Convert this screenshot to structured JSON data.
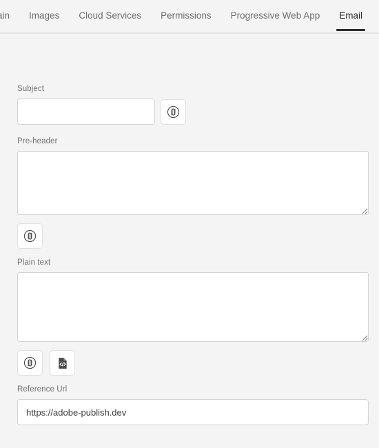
{
  "tabs": [
    {
      "label": "Main",
      "active": false,
      "name": "tab-main"
    },
    {
      "label": "Images",
      "active": false,
      "name": "tab-images"
    },
    {
      "label": "Cloud Services",
      "active": false,
      "name": "tab-cloud-services"
    },
    {
      "label": "Permissions",
      "active": false,
      "name": "tab-permissions"
    },
    {
      "label": "Progressive Web App",
      "active": false,
      "name": "tab-progressive-web-app"
    },
    {
      "label": "Email",
      "active": true,
      "name": "tab-email"
    }
  ],
  "form": {
    "subject": {
      "label": "Subject",
      "value": "",
      "placeholder": "",
      "personalize_button_icon": "personalization-token-icon"
    },
    "preheader": {
      "label": "Pre-header",
      "value": "",
      "placeholder": "",
      "personalize_button_icon": "personalization-token-icon"
    },
    "plain_text": {
      "label": "Plain text",
      "value": "",
      "placeholder": "",
      "personalize_button_icon": "personalization-token-icon",
      "source_button_icon": "code-document-icon"
    },
    "reference_url": {
      "label": "Reference Url",
      "value": "https://adobe-publish.dev",
      "placeholder": ""
    }
  },
  "colors": {
    "page_background": "#f4f4f4",
    "field_background": "#ffffff",
    "field_border": "#d3d3d3",
    "label_text": "#707070",
    "tab_text": "#6e6e6e",
    "tab_active_text": "#2c2c2c",
    "tab_active_underline": "#2c2c2c",
    "divider": "#e4e4e4",
    "icon_stroke": "#4b4b4b"
  }
}
